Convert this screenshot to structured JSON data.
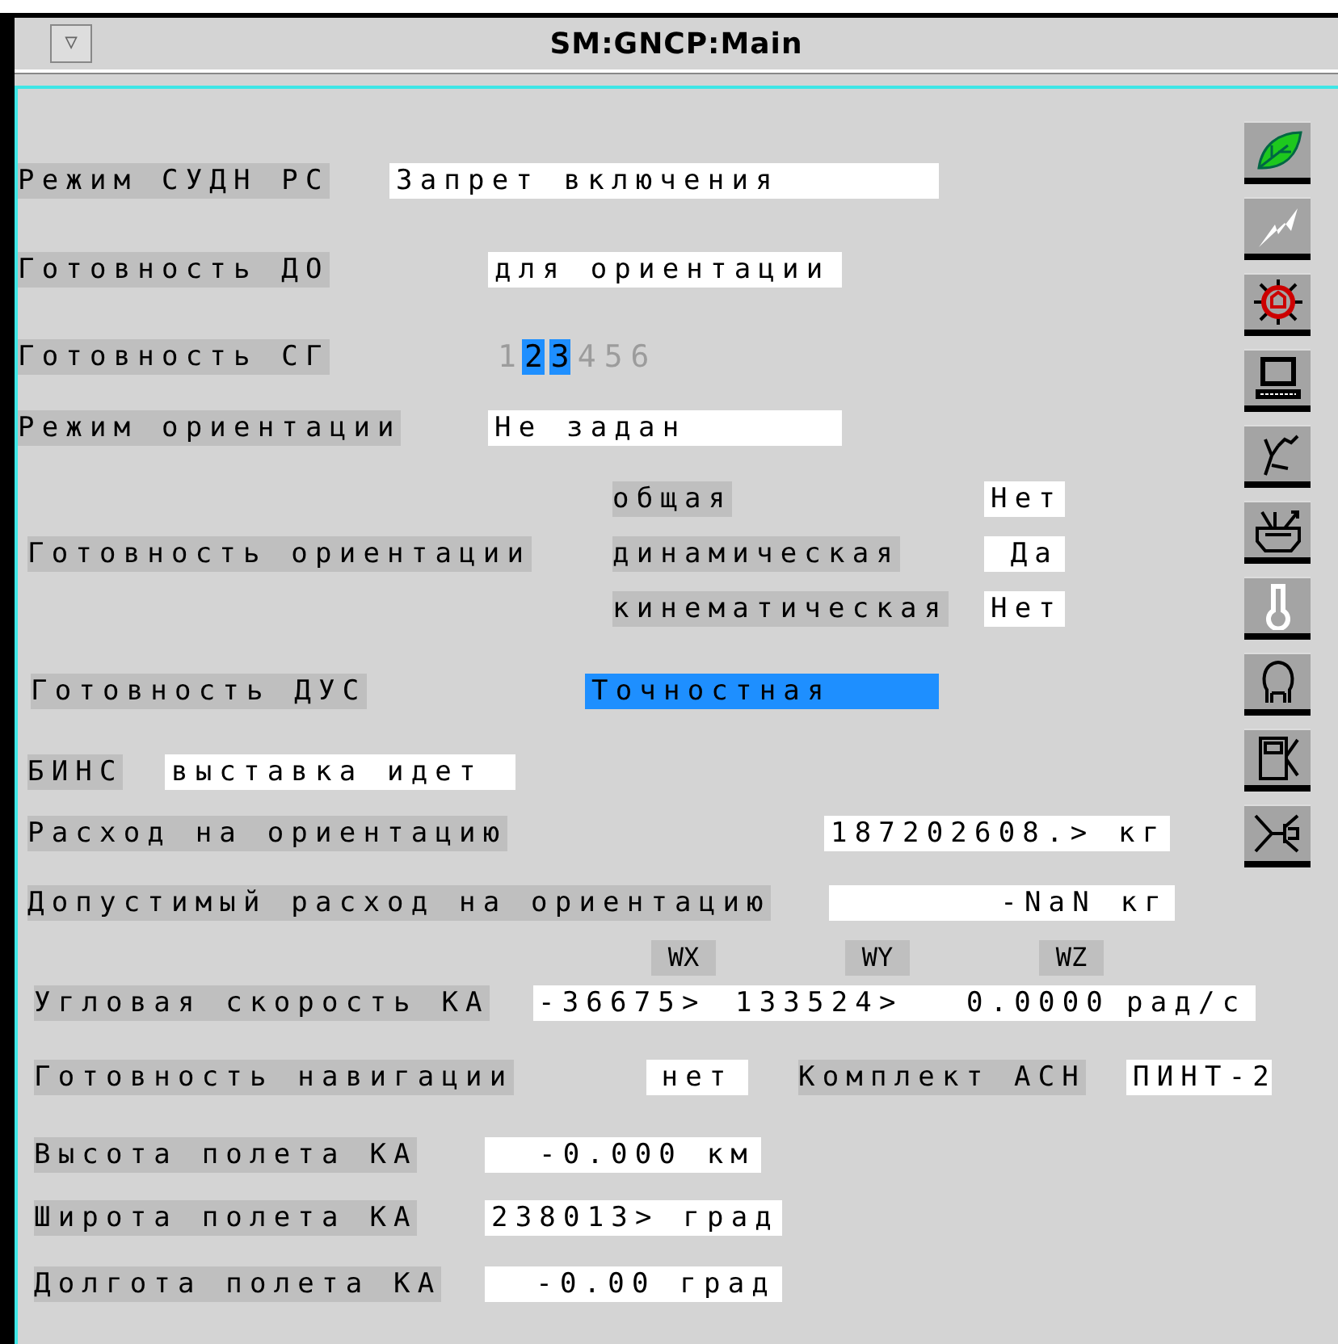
{
  "window": {
    "title": "SM:GNCP:Main",
    "menu_button": "▽"
  },
  "sudn_mode": {
    "label": "Режим СУДН РС",
    "value": "Запрет включения"
  },
  "do_readiness": {
    "label": "Готовность ДО",
    "value": "для ориентации"
  },
  "sg_readiness": {
    "label": "Готовность СГ",
    "digits": [
      {
        "text": "1",
        "selected": false
      },
      {
        "text": "2",
        "selected": true
      },
      {
        "text": "3",
        "selected": true
      },
      {
        "text": "4",
        "selected": false
      },
      {
        "text": "5",
        "selected": false
      },
      {
        "text": "6",
        "selected": false
      }
    ]
  },
  "orientation_mode": {
    "label": "Режим ориентации",
    "value": "Не задан"
  },
  "orientation_readiness": {
    "label": "Готовность ориентации",
    "items": [
      {
        "label": "общая",
        "value": "Нет"
      },
      {
        "label": "динамическая",
        "value": "Да"
      },
      {
        "label": "кинематическая",
        "value": "Нет"
      }
    ]
  },
  "dus_readiness": {
    "label": "Готовность ДУС",
    "value": "Точностная",
    "highlighted": true
  },
  "bins": {
    "label": "БИНС",
    "value": "выставка идет"
  },
  "consumption": {
    "label": "Расход на ориентацию",
    "value": "187202608.> кг"
  },
  "allowed_consumption": {
    "label": "Допустимый расход на ориентацию",
    "value": "-NaN кг"
  },
  "angular_velocity": {
    "label": "Угловая скорость КА",
    "unit": "рад/с",
    "components": [
      {
        "header": "WX",
        "value": "-36675>"
      },
      {
        "header": "WY",
        "value": "133524>"
      },
      {
        "header": "WZ",
        "value": "0.0000"
      }
    ]
  },
  "navigation_readiness": {
    "label": "Готовность навигации",
    "value": "нет"
  },
  "asn_set": {
    "label": "Комплект АСН",
    "value": "ПИНТ-2"
  },
  "altitude": {
    "label": "Высота полета КА",
    "value": "-0.000 км"
  },
  "latitude": {
    "label": "Широта полета КА",
    "value": "238013> град"
  },
  "longitude": {
    "label": "Долгота полета КА",
    "value": "-0.00 град"
  }
}
